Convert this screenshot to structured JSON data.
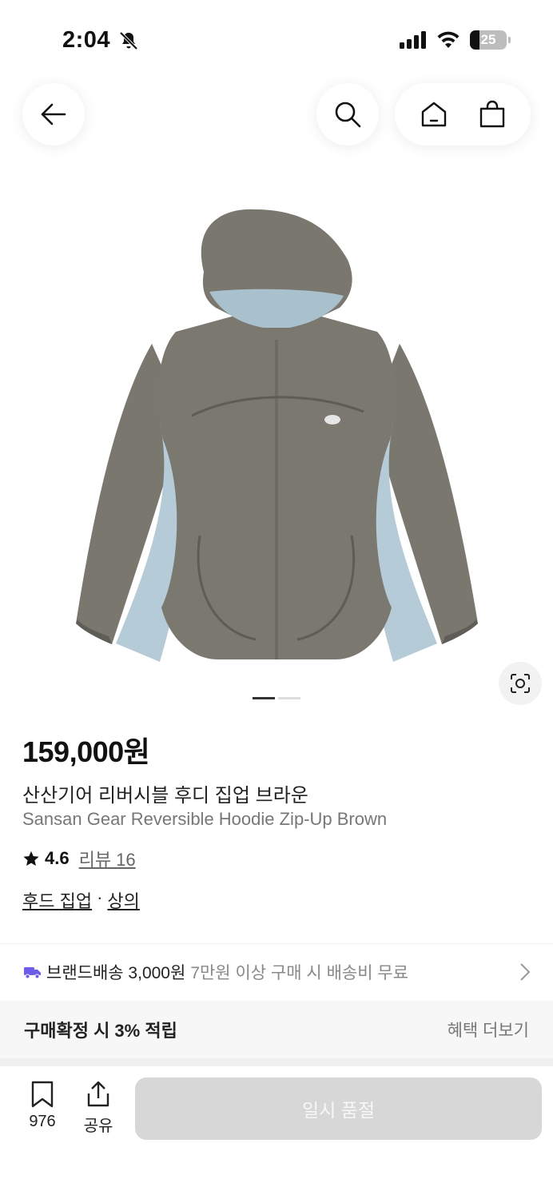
{
  "status_bar": {
    "time": "2:04",
    "battery": "25"
  },
  "nav": {
    "back_icon": "arrow-left-icon",
    "search_icon": "search-icon",
    "home_icon": "home-icon",
    "cart_icon": "shopping-bag-icon"
  },
  "product": {
    "image_description_icon": "product-hoodie",
    "page_indicator": {
      "current": 1,
      "total": 2
    },
    "price": "159,000원",
    "title_ko": "산산기어 리버시블 후디 집업 브라운",
    "title_en": "Sansan Gear Reversible Hoodie Zip-Up Brown",
    "rating": "4.6",
    "review_label": "리뷰 16",
    "categories": [
      "후드 집업",
      "상의"
    ],
    "category_separator": "·"
  },
  "shipping": {
    "label": "브랜드배송 3,000원",
    "detail": "7만원 이상 구매 시 배송비 무료",
    "icon": "truck-icon"
  },
  "benefit": {
    "label": "구매확정 시 3% 적립",
    "more": "혜택 더보기"
  },
  "bottom": {
    "save_count": "976",
    "share_label": "공유",
    "soldout_label": "일시 품절"
  },
  "colors": {
    "accent": "#6c5ce7",
    "disabled": "#d7d7d7"
  }
}
